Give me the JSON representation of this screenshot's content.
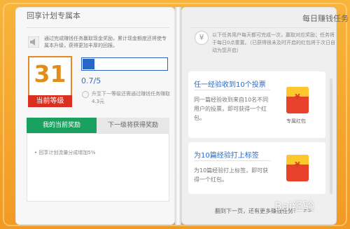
{
  "left": {
    "title": "回享计划专属本",
    "announcement": "通过完成赚钱任务赢取现金奖励，累计现金额度还将使专属本升级，获得更加丰厚的回报。",
    "level": "31",
    "level_label": "当前等级",
    "progress": "0.7/5",
    "progress_fraction": 0.14,
    "upgrade_text": "升至下一等级还需通过赚钱任务赚取4.3元",
    "tabs": [
      "我的当前奖励",
      "下一级将获得奖励"
    ],
    "reward_item": "回享计划流量分成增加5%"
  },
  "right": {
    "title": "每日赚钱任务",
    "announcement": "以下任务用户每天都可完成一次，赢取对应奖励；任务将于每日0点重置。（已获得很未及时开启的红包将于次日自动为您开启）",
    "tasks": [
      {
        "title": "任一经验收到10个投票",
        "desc": "同一篇经验收到来自10名不同用户的投票，即可获得一个红包。",
        "reward": "专属红包"
      },
      {
        "title": "为10篇经验打上标签",
        "desc": "为10篇经验打上标签，即可获得一个红包。",
        "reward": ""
      }
    ],
    "footer": "翻到下一页，还有更多赚钱任务！",
    "next_symbol": ">>"
  },
  "watermark": "Bai经验",
  "colors": {
    "accent": "#1aa15f",
    "level": "#e28d19",
    "blue": "#2e6bc4",
    "red": "#d9301f"
  }
}
